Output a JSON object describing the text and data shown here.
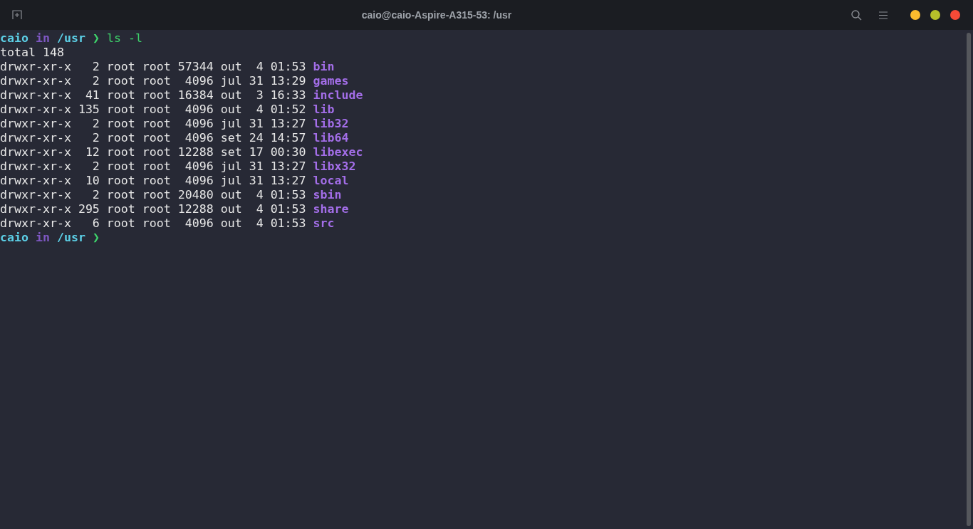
{
  "window": {
    "title": "caio@caio-Aspire-A315-53: /usr"
  },
  "session": [
    {
      "kind": "prompt",
      "user": "caio",
      "word": "in",
      "path": "/usr",
      "symbol": "❯",
      "command": "ls -l"
    },
    {
      "kind": "output",
      "text": "total 148"
    },
    {
      "kind": "entry",
      "text": "drwxr-xr-x   2 root root 57344 out  4 01:53",
      "name": "bin"
    },
    {
      "kind": "entry",
      "text": "drwxr-xr-x   2 root root  4096 jul 31 13:29",
      "name": "games"
    },
    {
      "kind": "entry",
      "text": "drwxr-xr-x  41 root root 16384 out  3 16:33",
      "name": "include"
    },
    {
      "kind": "entry",
      "text": "drwxr-xr-x 135 root root  4096 out  4 01:52",
      "name": "lib"
    },
    {
      "kind": "entry",
      "text": "drwxr-xr-x   2 root root  4096 jul 31 13:27",
      "name": "lib32"
    },
    {
      "kind": "entry",
      "text": "drwxr-xr-x   2 root root  4096 set 24 14:57",
      "name": "lib64"
    },
    {
      "kind": "entry",
      "text": "drwxr-xr-x  12 root root 12288 set 17 00:30",
      "name": "libexec"
    },
    {
      "kind": "entry",
      "text": "drwxr-xr-x   2 root root  4096 jul 31 13:27",
      "name": "libx32"
    },
    {
      "kind": "entry",
      "text": "drwxr-xr-x  10 root root  4096 jul 31 13:27",
      "name": "local"
    },
    {
      "kind": "entry",
      "text": "drwxr-xr-x   2 root root 20480 out  4 01:53",
      "name": "sbin"
    },
    {
      "kind": "entry",
      "text": "drwxr-xr-x 295 root root 12288 out  4 01:53",
      "name": "share"
    },
    {
      "kind": "entry",
      "text": "drwxr-xr-x   6 root root  4096 out  4 01:53",
      "name": "src"
    },
    {
      "kind": "prompt",
      "user": "caio",
      "word": "in",
      "path": "/usr",
      "symbol": "❯"
    }
  ]
}
